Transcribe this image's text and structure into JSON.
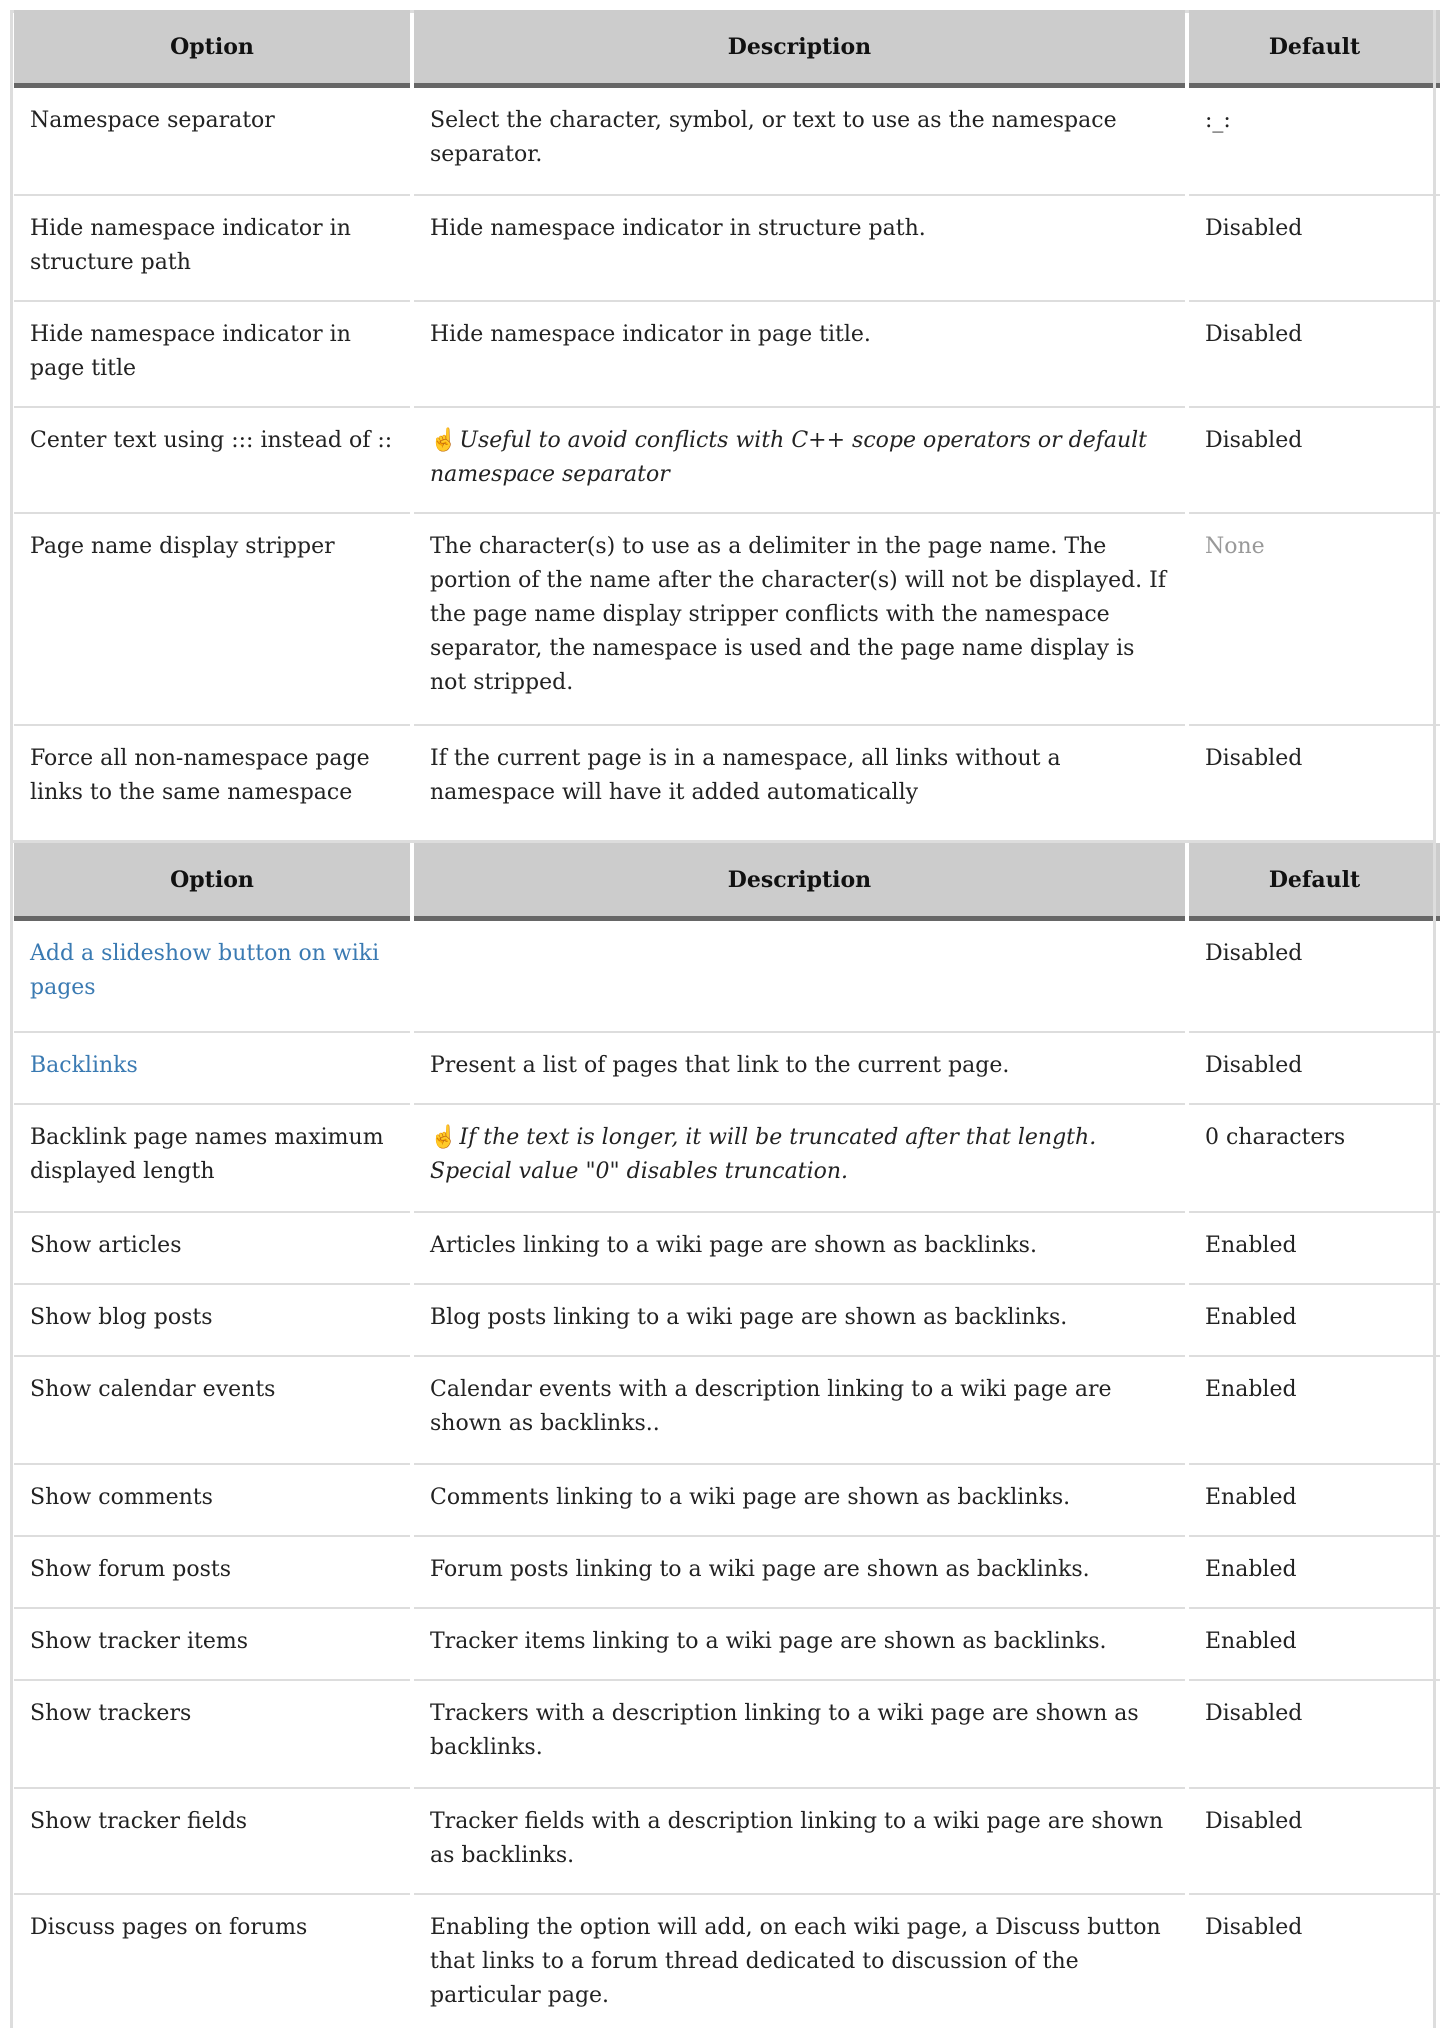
{
  "table1": {
    "headers": {
      "option": "Option",
      "description": "Description",
      "default": "Default"
    },
    "rows": [
      {
        "option": "Namespace separator",
        "description": "Select the character, symbol, or text to use as the namespace separator.",
        "default": ":_:"
      },
      {
        "option": "Hide namespace indicator in structure path",
        "description": "Hide namespace indicator in structure path.",
        "default": "Disabled"
      },
      {
        "option": "Hide namespace indicator in page title",
        "description": "Hide namespace indicator in page title.",
        "default": "Disabled"
      },
      {
        "option": "Center text using ::: instead of ::",
        "description": "Useful to avoid conflicts with C++ scope operators or default namespace separator",
        "default": "Disabled"
      },
      {
        "option": "Page name display stripper",
        "description": "The character(s) to use as a delimiter in the page name. The portion of the name after the character(s) will not be displayed. If the page name display stripper conflicts with the namespace separator, the namespace is used and the page name display is not stripped.",
        "default": "None"
      },
      {
        "option": "Force all non-namespace page links to the same namespace",
        "description": "If the current page is in a namespace, all links without a namespace will have it added automatically",
        "default": "Disabled"
      }
    ]
  },
  "table2": {
    "headers": {
      "option": "Option",
      "description": "Description",
      "default": "Default"
    },
    "rows": [
      {
        "option": "Add a slideshow button on wiki pages",
        "description": "",
        "default": "Disabled"
      },
      {
        "option": "Backlinks",
        "description": "Present a list of pages that link to the current page.",
        "default": "Disabled"
      },
      {
        "option": "Backlink page names maximum displayed length",
        "description": "If the text is longer, it will be truncated after that length. Special value \"0\" disables truncation.",
        "default": "0 characters"
      },
      {
        "option": "Show articles",
        "description": "Articles linking to a wiki page are shown as backlinks.",
        "default": "Enabled"
      },
      {
        "option": "Show blog posts",
        "description": "Blog posts linking to a wiki page are shown as backlinks.",
        "default": "Enabled"
      },
      {
        "option": "Show calendar events",
        "description": "Calendar events with a description linking to a wiki page are shown as backlinks..",
        "default": "Enabled"
      },
      {
        "option": "Show comments",
        "description": "Comments linking to a wiki page are shown as backlinks.",
        "default": "Enabled"
      },
      {
        "option": "Show forum posts",
        "description": "Forum posts linking to a wiki page are shown as backlinks.",
        "default": "Enabled"
      },
      {
        "option": "Show tracker items",
        "description": "Tracker items linking to a wiki page are shown as backlinks.",
        "default": "Enabled"
      },
      {
        "option": "Show trackers",
        "description": "Trackers with a description linking to a wiki page are shown as backlinks.",
        "default": "Disabled"
      },
      {
        "option": "Show tracker fields",
        "description": "Tracker fields with a description linking to a wiki page are shown as backlinks.",
        "default": "Disabled"
      },
      {
        "option": "Discuss pages on forums",
        "description": "Enabling the option will add, on each wiki page, a Discuss button that links to a forum thread dedicated to discussion of the particular page.",
        "default": "Disabled"
      }
    ]
  },
  "icons": {
    "hint": "pointing-hand-icon"
  },
  "colors": {
    "header_bg": "#cccccc",
    "header_rule": "#666666",
    "row_rule": "#dddddd",
    "link": "#3a7ab2",
    "muted": "#999999"
  }
}
